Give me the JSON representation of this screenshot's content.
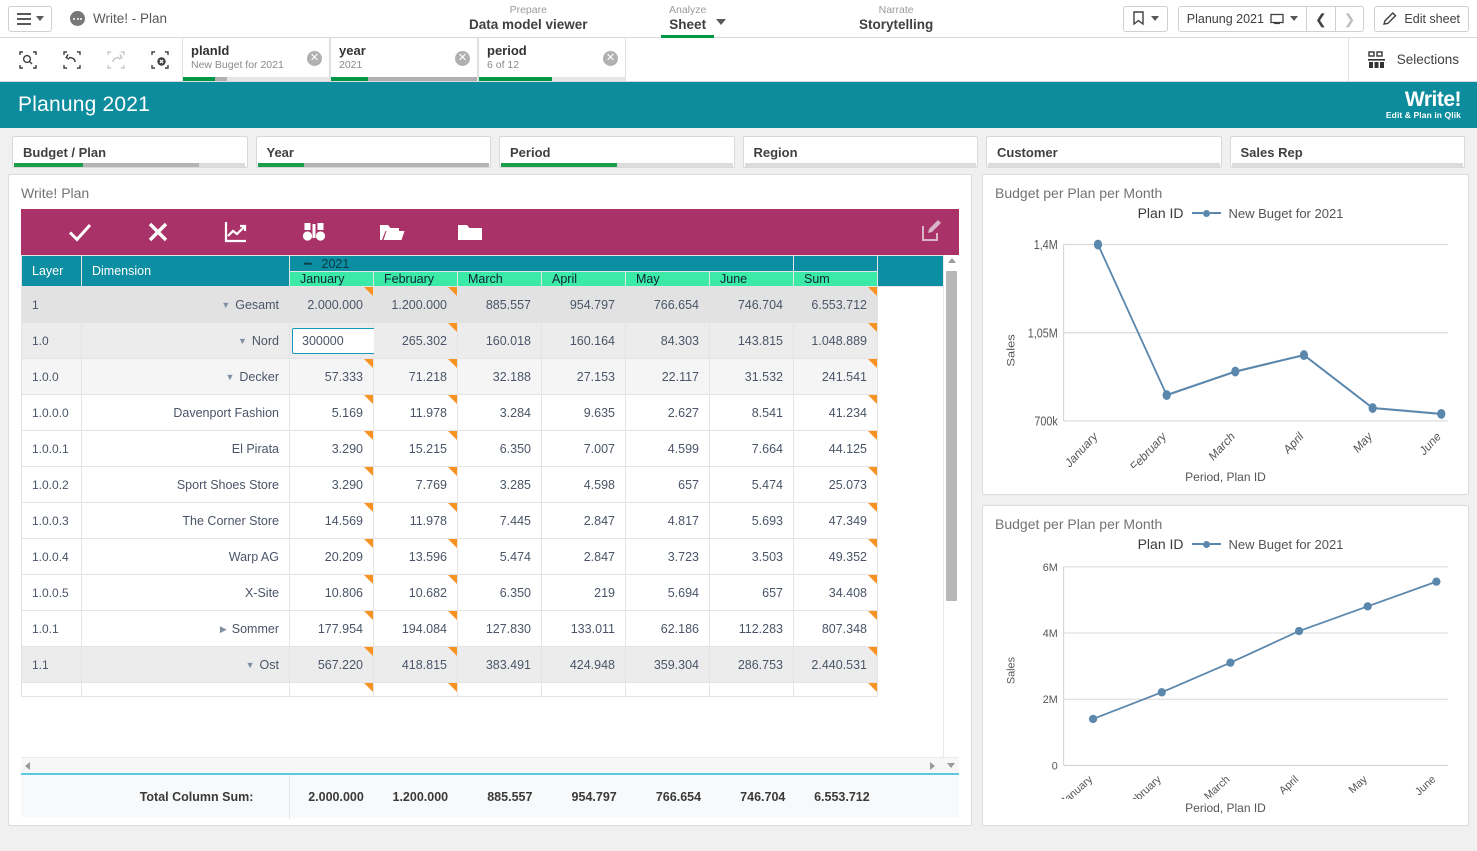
{
  "topbar": {
    "app_title": "Write! - Plan",
    "nav": [
      {
        "small": "Prepare",
        "big": "Data model viewer",
        "active": false
      },
      {
        "small": "Analyze",
        "big": "Sheet",
        "active": true
      },
      {
        "small": "Narrate",
        "big": "Storytelling",
        "active": false
      }
    ],
    "sheet_selector": "Planung 2021",
    "edit_sheet": "Edit sheet"
  },
  "selections": {
    "button_label": "Selections",
    "chips": [
      {
        "field": "planId",
        "value": "New Buget for 2021",
        "green": 22,
        "gray": 8,
        "empty": 70
      },
      {
        "field": "year",
        "value": "2021",
        "green": 25,
        "gray": 75,
        "empty": 0
      },
      {
        "field": "period",
        "value": "6 of 12",
        "green": 50,
        "gray": 0,
        "empty": 50
      }
    ]
  },
  "app_header": {
    "title": "Planung 2021",
    "logo_main": "Write!",
    "logo_sub": "Edit & Plan in Qlik"
  },
  "filters": [
    {
      "label": "Budget / Plan",
      "green": 30,
      "gray": 50,
      "empty": 20
    },
    {
      "label": "Year",
      "green": 20,
      "gray": 80,
      "empty": 0
    },
    {
      "label": "Period",
      "green": 50,
      "gray": 0,
      "empty": 50
    },
    {
      "label": "Region",
      "green": 0,
      "gray": 0,
      "empty": 100
    },
    {
      "label": "Customer",
      "green": 0,
      "gray": 0,
      "empty": 100
    },
    {
      "label": "Sales Rep",
      "green": 0,
      "gray": 0,
      "empty": 100
    }
  ],
  "table_panel": {
    "title": "Write! Plan",
    "toolbar_icons": [
      "check-icon",
      "close-icon",
      "chart-icon",
      "binoculars-icon",
      "folder-open-icon",
      "folder-icon",
      "edit-icon"
    ],
    "headers": {
      "layer": "Layer",
      "dimension": "Dimension",
      "year_group": "2021",
      "months": [
        "January",
        "February",
        "March",
        "April",
        "May",
        "June"
      ],
      "sum": "Sum"
    },
    "rows": [
      {
        "layer": "1",
        "name": "Gesamt",
        "level": 1,
        "indent": 0,
        "toggle": "down",
        "values": [
          "2.000.000",
          "1.200.000",
          "885.557",
          "954.797",
          "766.654",
          "746.704",
          "6.553.712"
        ],
        "edit_index": -1
      },
      {
        "layer": "1.0",
        "name": "Nord",
        "level": 2,
        "indent": 1,
        "toggle": "down",
        "values": [
          "300000",
          "265.302",
          "160.018",
          "160.164",
          "84.303",
          "143.815",
          "1.048.889"
        ],
        "edit_index": 0
      },
      {
        "layer": "1.0.0",
        "name": "Decker",
        "level": 3,
        "indent": 2,
        "toggle": "down",
        "values": [
          "57.333",
          "71.218",
          "32.188",
          "27.153",
          "22.117",
          "31.532",
          "241.541"
        ],
        "edit_index": -1
      },
      {
        "layer": "1.0.0.0",
        "name": "Davenport Fashion",
        "level": 4,
        "indent": 3,
        "toggle": "",
        "values": [
          "5.169",
          "11.978",
          "3.284",
          "9.635",
          "2.627",
          "8.541",
          "41.234"
        ],
        "edit_index": -1
      },
      {
        "layer": "1.0.0.1",
        "name": "El Pirata",
        "level": 4,
        "indent": 3,
        "toggle": "",
        "values": [
          "3.290",
          "15.215",
          "6.350",
          "7.007",
          "4.599",
          "7.664",
          "44.125"
        ],
        "edit_index": -1
      },
      {
        "layer": "1.0.0.2",
        "name": "Sport Shoes Store",
        "level": 4,
        "indent": 3,
        "toggle": "",
        "values": [
          "3.290",
          "7.769",
          "3.285",
          "4.598",
          "657",
          "5.474",
          "25.073"
        ],
        "edit_index": -1
      },
      {
        "layer": "1.0.0.3",
        "name": "The Corner Store",
        "level": 4,
        "indent": 3,
        "toggle": "",
        "values": [
          "14.569",
          "11.978",
          "7.445",
          "2.847",
          "4.817",
          "5.693",
          "47.349"
        ],
        "edit_index": -1
      },
      {
        "layer": "1.0.0.4",
        "name": "Warp AG",
        "level": 4,
        "indent": 3,
        "toggle": "",
        "values": [
          "20.209",
          "13.596",
          "5.474",
          "2.847",
          "3.723",
          "3.503",
          "49.352"
        ],
        "edit_index": -1
      },
      {
        "layer": "1.0.0.5",
        "name": "X-Site",
        "level": 4,
        "indent": 3,
        "toggle": "",
        "values": [
          "10.806",
          "10.682",
          "6.350",
          "219",
          "5.694",
          "657",
          "34.408"
        ],
        "edit_index": -1
      },
      {
        "layer": "1.0.1",
        "name": "Sommer",
        "level": 4,
        "indent": 2,
        "toggle": "right",
        "values": [
          "177.954",
          "194.084",
          "127.830",
          "133.011",
          "62.186",
          "112.283",
          "807.348"
        ],
        "edit_index": -1
      },
      {
        "layer": "1.1",
        "name": "Ost",
        "level": 2,
        "indent": 1,
        "toggle": "down",
        "values": [
          "567.220",
          "418.815",
          "383.491",
          "424.948",
          "359.304",
          "286.753",
          "2.440.531"
        ],
        "edit_index": -1
      }
    ],
    "total_label": "Total Column Sum:",
    "total_values": [
      "2.000.000",
      "1.200.000",
      "885.557",
      "954.797",
      "766.654",
      "746.704",
      "6.553.712"
    ]
  },
  "chart_data": [
    {
      "type": "line",
      "title": "Budget per Plan per Month",
      "legend_title": "Plan ID",
      "series": [
        {
          "name": "New Buget for 2021",
          "values": [
            1400000,
            800000,
            890000,
            950000,
            753000,
            740000
          ]
        }
      ],
      "categories": [
        "January",
        "February",
        "March",
        "April",
        "May",
        "June"
      ],
      "xlabel": "Period, Plan ID",
      "ylabel": "Sales",
      "yticks": [
        "700k",
        "1,05M",
        "1,4M"
      ],
      "ylim": [
        700000,
        1400000
      ],
      "grid": true,
      "legend_position": "top",
      "color": "#5b87ad"
    },
    {
      "type": "line",
      "title": "Budget per Plan per Month",
      "legend_title": "Plan ID",
      "series": [
        {
          "name": "New Buget for 2021",
          "values": [
            1400000,
            2200000,
            3100000,
            4050000,
            4800000,
            5550000
          ]
        }
      ],
      "categories": [
        "January",
        "February",
        "March",
        "April",
        "May",
        "June"
      ],
      "xlabel": "Period, Plan ID",
      "ylabel": "Sales",
      "yticks": [
        "0",
        "2M",
        "4M",
        "6M"
      ],
      "ylim": [
        0,
        6000000
      ],
      "grid": true,
      "legend_position": "top",
      "color": "#5b87ad"
    }
  ],
  "colors": {
    "teal": "#0d8c9e",
    "magenta": "#a93268",
    "mint": "#3ceaa8",
    "green": "#009845",
    "orange": "#f79421",
    "chart_blue": "#5b87ad"
  }
}
